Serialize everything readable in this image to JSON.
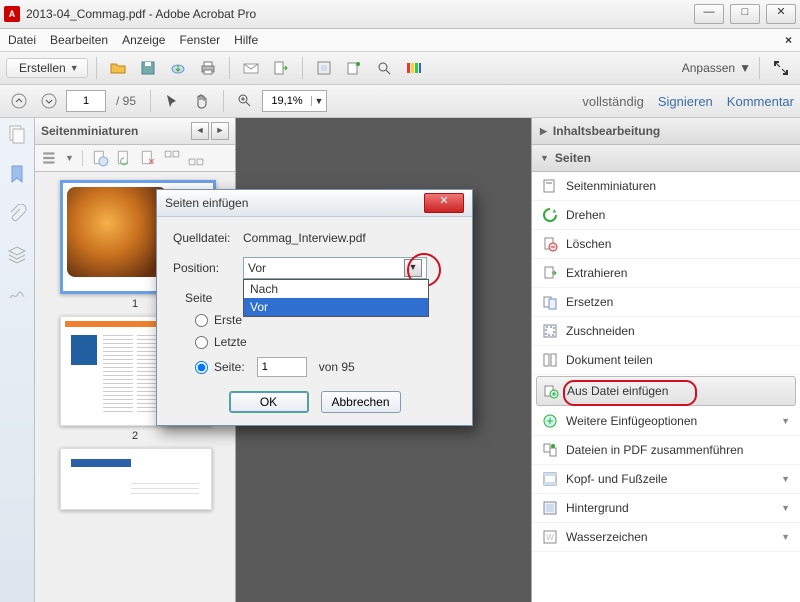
{
  "window": {
    "title": "2013-04_Commag.pdf - Adobe Acrobat Pro"
  },
  "menu": {
    "datei": "Datei",
    "bearbeiten": "Bearbeiten",
    "anzeige": "Anzeige",
    "fenster": "Fenster",
    "hilfe": "Hilfe"
  },
  "toolbar": {
    "erstellen": "Erstellen",
    "anpassen": "Anpassen",
    "page_current": "1",
    "page_total": "/  95",
    "zoom": "19,1%"
  },
  "rightlinks": {
    "vollstaendig": "vollständig",
    "signieren": "Signieren",
    "kommentar": "Kommentar"
  },
  "thumbpanel": {
    "title": "Seitenminiaturen",
    "pages": [
      "1",
      "2"
    ]
  },
  "rightpanel": {
    "section1": "Inhaltsbearbeitung",
    "section2": "Seiten",
    "tools": [
      "Seitenminiaturen",
      "Drehen",
      "Löschen",
      "Extrahieren",
      "Ersetzen",
      "Zuschneiden",
      "Dokument teilen",
      "Aus Datei einfügen",
      "Weitere Einfügeoptionen",
      "Dateien in PDF zusammenführen",
      "Kopf- und Fußzeile",
      "Hintergrund",
      "Wasserzeichen"
    ]
  },
  "dialog": {
    "title": "Seiten einfügen",
    "source_label": "Quelldatei:",
    "source_file": "Commag_Interview.pdf",
    "position_label": "Position:",
    "position_value": "Vor",
    "options": {
      "nach": "Nach",
      "vor": "Vor"
    },
    "group": "Seite",
    "erste": "Erste",
    "letzte": "Letzte",
    "seite": "Seite:",
    "seite_val": "1",
    "seite_total": "von 95",
    "ok": "OK",
    "cancel": "Abbrechen"
  }
}
